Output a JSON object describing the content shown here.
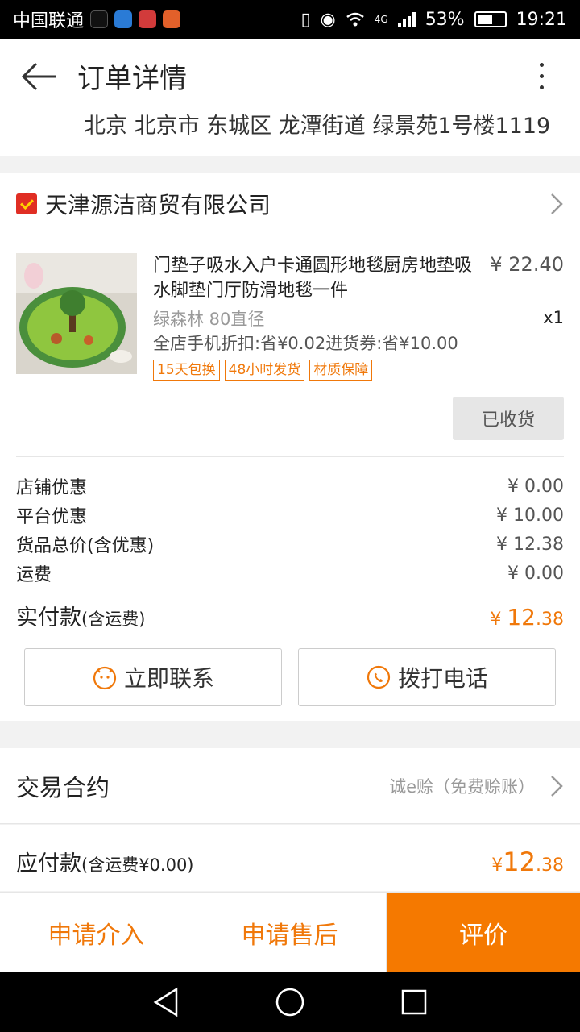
{
  "status_bar": {
    "carrier": "中国联通",
    "network": "4G",
    "battery": "53%",
    "time": "19:21"
  },
  "header": {
    "title": "订单详情"
  },
  "address": {
    "line": "北京 北京市 东城区 龙潭街道 绿景苑1号楼1119"
  },
  "store": {
    "name": "天津源洁商贸有限公司",
    "item": {
      "title": "门垫子吸水入户卡通圆形地毯厨房地垫吸水脚垫门厅防滑地毯一件",
      "price": "¥ 22.40",
      "sku": "绿森林 80直径",
      "qty": "x1",
      "discount": "全店手机折扣:省¥0.02进货券:省¥10.00",
      "tags": [
        "15天包换",
        "48小时发货",
        "材质保障"
      ]
    },
    "received_label": "已收货",
    "fees": [
      {
        "label": "店铺优惠",
        "value": "¥ 0.00"
      },
      {
        "label": "平台优惠",
        "value": "¥ 10.00"
      },
      {
        "label": "货品总价(含优惠)",
        "value": "¥ 12.38"
      },
      {
        "label": "运费",
        "value": "¥ 0.00"
      }
    ],
    "paid": {
      "label": "实付款",
      "sub": "(含运费)",
      "currency": "¥ ",
      "int": "12",
      "dec": ".38"
    },
    "contact_label": "立即联系",
    "call_label": "拨打电话"
  },
  "contract": {
    "label": "交易合约",
    "value": "诚e赊（免费赊账）"
  },
  "payable": {
    "label": "应付款",
    "sub": "(含运费¥0.00)",
    "currency": "¥",
    "int": "12",
    "dec": ".38"
  },
  "bottom_bar": {
    "intervene": "申请介入",
    "after_sale": "申请售后",
    "review": "评价"
  },
  "colors": {
    "accent": "#f57900",
    "price_orange": "#f0780a"
  }
}
